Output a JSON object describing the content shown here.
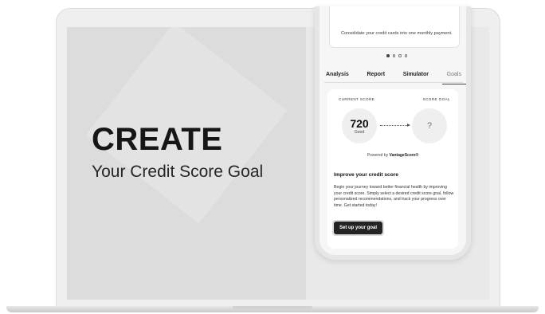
{
  "hero": {
    "headline": "CREATE",
    "subheadline": "Your Credit Score Goal"
  },
  "phone": {
    "promo_text": "Consolidate your credit cards into one monthly payment.",
    "carousel": {
      "count": 4,
      "active_index": 0
    },
    "tabs": [
      {
        "label": "Analysis",
        "active": false
      },
      {
        "label": "Report",
        "active": false
      },
      {
        "label": "Simulator",
        "active": false
      },
      {
        "label": "Goals",
        "active": true
      }
    ],
    "score": {
      "current_label": "CURRENT SCORE",
      "goal_label": "SCORE GOAL",
      "current_value": "720",
      "current_rating": "Good",
      "goal_value": "?",
      "powered_prefix": "Powered by ",
      "powered_brand": "VantageScore®"
    },
    "improve": {
      "title": "Improve your credit score",
      "body": "Begin your journey toward better financial health by improving your credit score. Simply select a desired credit score goal, follow personalized recommendations, and track your progress over time. Get started today!",
      "button_label": "Set up your goal"
    }
  },
  "colors": {
    "button_bg": "#232323",
    "screen_bg": "#e4e4e4"
  }
}
